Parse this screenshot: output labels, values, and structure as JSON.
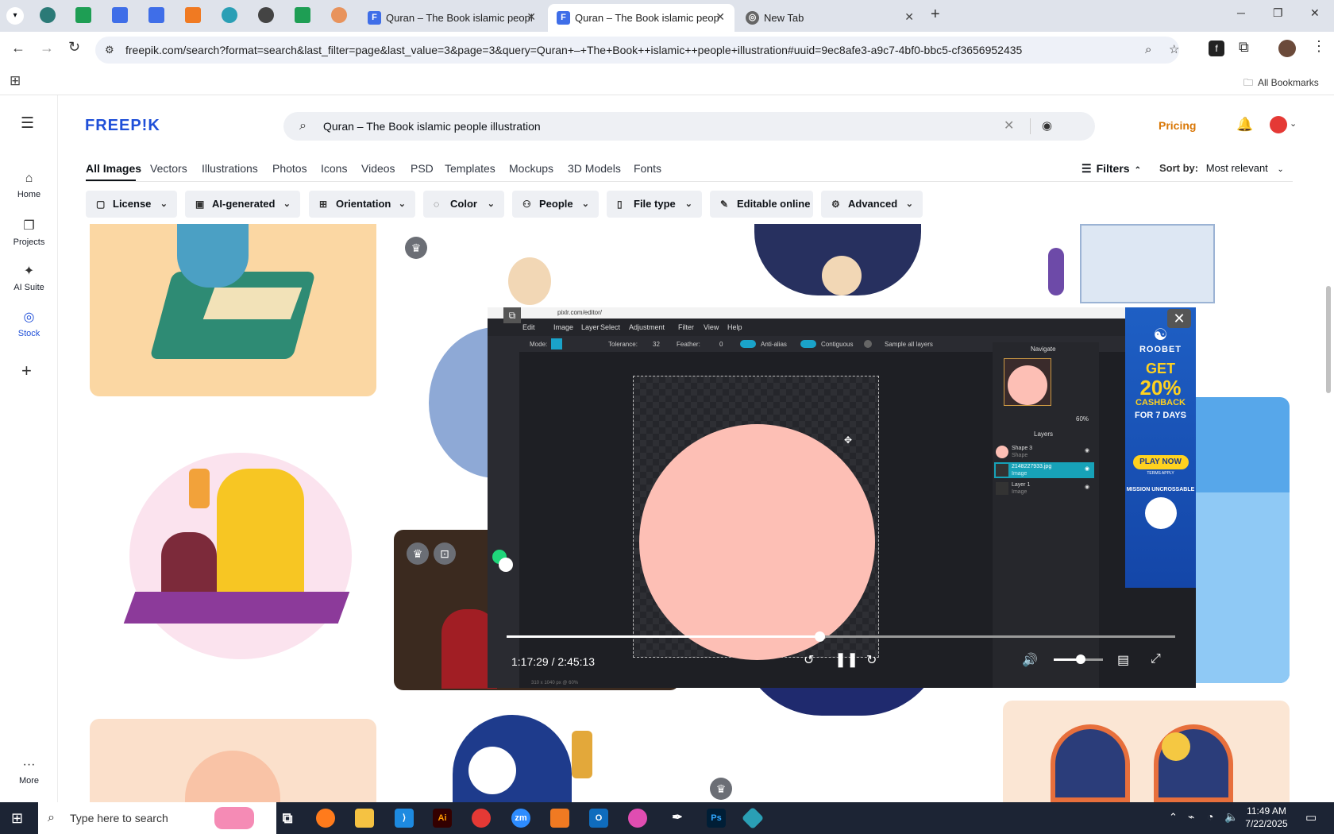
{
  "browser": {
    "tabs": [
      {
        "title": "Quran – The Book islamic peopl",
        "active": false
      },
      {
        "title": "Quran – The Book islamic peop",
        "active": true
      },
      {
        "title": "New Tab",
        "active": false
      }
    ],
    "new_tab_glyph": "+",
    "url": "freepik.com/search?format=search&last_filter=page&last_value=3&page=3&query=Quran+–+The+Book++islamic++people+illustration#uuid=9ec8afe3-a9c7-4bf0-bbc5-cf3656952435",
    "bookmarks_label": "All Bookmarks"
  },
  "freepik": {
    "logo": "FREEP!K",
    "search_value": "Quran – The Book  islamic  people illustration",
    "pricing": "Pricing",
    "nav": [
      {
        "label": "Home",
        "icon": "home-icon"
      },
      {
        "label": "Projects",
        "icon": "projects-icon"
      },
      {
        "label": "AI Suite",
        "icon": "ai-suite-icon"
      },
      {
        "label": "Stock",
        "icon": "stock-icon"
      },
      {
        "label": "More",
        "icon": "more-icon"
      }
    ],
    "tabs": [
      "All Images",
      "Vectors",
      "Illustrations",
      "Photos",
      "Icons",
      "Videos",
      "PSD",
      "Templates",
      "Mockups",
      "3D Models",
      "Fonts"
    ],
    "filters_label": "Filters",
    "sort_label": "Sort by:",
    "sort_value": "Most relevant",
    "chips": [
      "License",
      "AI-generated",
      "Orientation",
      "Color",
      "People",
      "File type",
      "Editable online",
      "Advanced"
    ]
  },
  "player": {
    "pixlr_url": "pixlr.com/editor/",
    "menu": [
      "Edit",
      "Image",
      "Layer",
      "Select",
      "Adjustment",
      "Filter",
      "View",
      "Help"
    ],
    "options": {
      "mode": "Mode:",
      "tolerance": "Tolerance:",
      "tolerance_value": "32",
      "feather": "Feather:",
      "feather_value": "0",
      "antialias": "Anti-alias",
      "contiguous": "Contiguous",
      "sample": "Sample all layers"
    },
    "navigate_title": "Navigate",
    "zoom": "60%",
    "layers_title": "Layers",
    "layers": [
      {
        "name": "Shape 3",
        "type": "Shape"
      },
      {
        "name": "21482279​33.jpg",
        "type": "Image"
      },
      {
        "name": "Layer 1",
        "type": "Image"
      }
    ],
    "ad": {
      "brand": "ROOBET",
      "get": "GET",
      "percent": "20%",
      "cashback": "CASHBACK",
      "days": "FOR 7 DAYS",
      "cta": "PLAY NOW",
      "terms": "TERMS APPLY",
      "tag": "MISSION UNCROSSABLE"
    },
    "time": "1:17:29 / 2:45:13",
    "progress": 0.468,
    "volume": 0.55,
    "canvas_size": "310 x 1040 px @ 60%"
  },
  "taskbar": {
    "search_placeholder": "Type here to search",
    "clock_time": "11:49 AM",
    "clock_date": "7/22/2025"
  },
  "colors": {
    "freepik_blue": "#1f4fd8",
    "pricing": "#d97706",
    "circle": "#fdbfb5",
    "accent_teal": "#17a2b8"
  }
}
